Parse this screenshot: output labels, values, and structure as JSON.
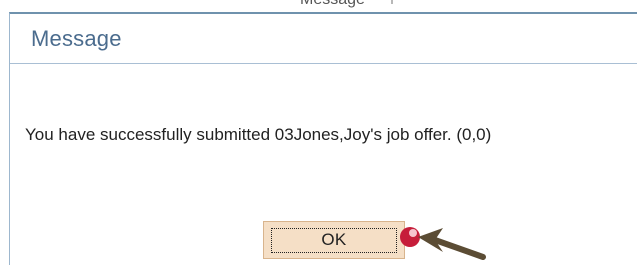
{
  "top_strip": {
    "clipped_text": "Message"
  },
  "dialog": {
    "title": "Message",
    "message": "You have successfully submitted 03Jones,Joy's job offer. (0,0)",
    "ok_label": "OK"
  },
  "annotation": {
    "icon": "arrow-pointer-icon",
    "dot_color": "#c61d3a",
    "arrow_color": "#5b4c34"
  }
}
